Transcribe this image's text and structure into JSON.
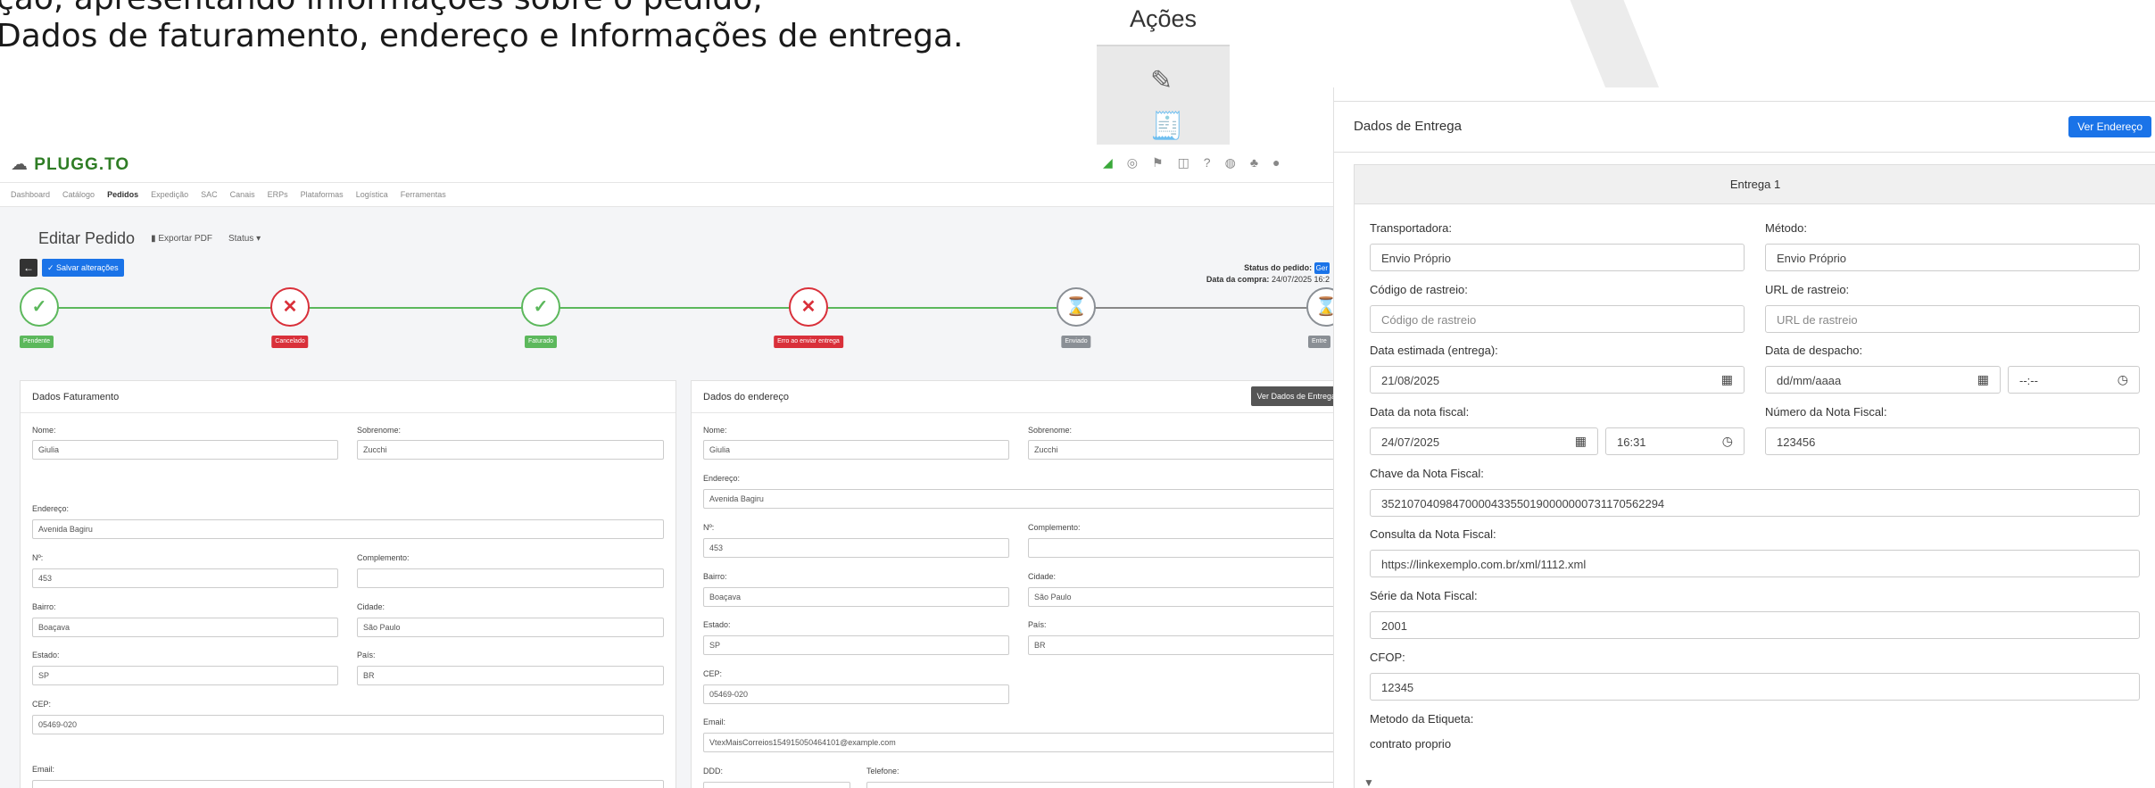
{
  "caption": {
    "line1": "ção, apresentando informações sobre o pedido,",
    "line2": "Dados de faturamento, endereço e Informações de entrega."
  },
  "acoes": {
    "header": "Ações",
    "edit_icon": "pencil-icon",
    "receipt_icon": "receipt-icon"
  },
  "app": {
    "logo": "PLUGG.TO",
    "nav": [
      "Dashboard",
      "Catálogo",
      "Pedidos",
      "Expedição",
      "SAC",
      "Canais",
      "ERPs",
      "Plataformas",
      "Logística",
      "Ferramentas"
    ],
    "title": "Editar Pedido",
    "export_pdf": "Exportar PDF",
    "status_menu": "Status",
    "save_btn": "Salvar alterações",
    "status_label": "Status do pedido:",
    "status_value": "Ger",
    "purchase_label": "Data da compra:",
    "purchase_value": "24/07/2025 16:2",
    "steps": [
      {
        "label": "Pendente",
        "state": "ok",
        "glyph": "✓"
      },
      {
        "label": "Cancelado",
        "state": "err",
        "glyph": "✕"
      },
      {
        "label": "Faturado",
        "state": "ok",
        "glyph": "✓"
      },
      {
        "label": "Erro ao enviar entrega",
        "state": "err",
        "glyph": "✕"
      },
      {
        "label": "Enviado",
        "state": "wait",
        "glyph": "⌛"
      },
      {
        "label": "Entre",
        "state": "wait",
        "glyph": "⌛"
      }
    ],
    "faturamento": {
      "title": "Dados Faturamento",
      "nome_label": "Nome:",
      "nome": "Giulia",
      "sobrenome_label": "Sobrenome:",
      "sobrenome": "Zucchi",
      "endereco_label": "Endereço:",
      "endereco": "Avenida Bagiru",
      "numero_label": "Nº:",
      "numero": "453",
      "complemento_label": "Complemento:",
      "complemento": "",
      "bairro_label": "Bairro:",
      "bairro": "Boaçava",
      "cidade_label": "Cidade:",
      "cidade": "São Paulo",
      "estado_label": "Estado:",
      "estado": "SP",
      "pais_label": "País:",
      "pais": "BR",
      "cep_label": "CEP:",
      "cep": "05469-020",
      "email_label": "Email:"
    },
    "endereco": {
      "title": "Dados do endereço",
      "button": "Ver Dados de Entrega",
      "nome_label": "Nome:",
      "nome": "Giulia",
      "sobrenome_label": "Sobrenome:",
      "sobrenome": "Zucchi",
      "endereco_label": "Endereço:",
      "endereco": "Avenida Bagiru",
      "numero_label": "Nº:",
      "numero": "453",
      "complemento_label": "Complemento:",
      "complemento": "",
      "bairro_label": "Bairro:",
      "bairro": "Boaçava",
      "cidade_label": "Cidade:",
      "cidade": "São Paulo",
      "estado_label": "Estado:",
      "estado": "SP",
      "pais_label": "País:",
      "pais": "BR",
      "cep_label": "CEP:",
      "cep": "05469-020",
      "email_label": "Email:",
      "email": "VtexMaisCorreios154915050464101@example.com",
      "ddd_label": "DDD:",
      "telefone_label": "Telefone:"
    }
  },
  "entrega": {
    "title": "Dados de Entrega",
    "ver_endereco": "Ver Endereço",
    "box_title": "Entrega 1",
    "transportadora_label": "Transportadora:",
    "transportadora": "Envio Próprio",
    "metodo_label": "Método:",
    "metodo": "Envio Próprio",
    "rastreio_label": "Código de rastreio:",
    "rastreio_ph": "Código de rastreio",
    "url_label": "URL de rastreio:",
    "url_ph": "URL de rastreio",
    "data_est_label": "Data estimada (entrega):",
    "data_est": "21/08/2025",
    "despacho_label": "Data de despacho:",
    "despacho_ph": "dd/mm/aaaa",
    "despacho_time_ph": "--:--",
    "data_nf_label": "Data da nota fiscal:",
    "data_nf": "24/07/2025",
    "hora_nf": "16:31",
    "numero_nf_label": "Número da Nota Fiscal:",
    "numero_nf": "123456",
    "chave_label": "Chave da Nota Fiscal:",
    "chave": "35210704098470000433550190000000731170562294",
    "consulta_label": "Consulta da Nota Fiscal:",
    "consulta": "https://linkexemplo.com.br/xml/1112.xml",
    "serie_label": "Série da Nota Fiscal:",
    "serie": "2001",
    "cfop_label": "CFOP:",
    "cfop": "12345",
    "etiqueta_label": "Metodo da Etiqueta:",
    "etiqueta": "contrato proprio"
  }
}
